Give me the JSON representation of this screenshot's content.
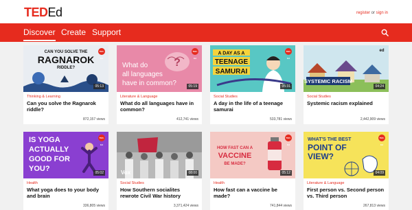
{
  "header": {
    "logo_ted": "TED",
    "logo_ed": "Ed",
    "register": "register",
    "or": " or ",
    "sign_in": "sign in"
  },
  "nav": {
    "items": [
      "Discover",
      "Create",
      "Support"
    ]
  },
  "colors": {
    "brand": "#e62b1e"
  },
  "cards": [
    {
      "thumb_text": [
        "CAN YOU SOLVE THE",
        "RAGNAROK",
        "RIDDLE?"
      ],
      "badge": "TED-Ed",
      "duration": "05:13",
      "subject": "Thinking & Learning",
      "title": "Can you solve the Ragnarok riddle?",
      "views": "872,157 views"
    },
    {
      "thumb_text": [
        "What do",
        "all languages",
        "have in common?"
      ],
      "badge": "TED-Ed",
      "duration": "05:19",
      "subject": "Literature & Language",
      "title": "What do all languages have in common?",
      "views": "412,741 views"
    },
    {
      "thumb_text": [
        "A DAY AS A",
        "TEENAGE",
        "SAMURAI"
      ],
      "badge": "TED-Ed",
      "duration": "05:31",
      "subject": "Social Studies",
      "title": "A day in the life of a teenage samurai",
      "views": "533,781 views"
    },
    {
      "thumb_text": [
        "SYSTEMIC RACISM",
        "ed"
      ],
      "badge": "",
      "duration": "04:24",
      "subject": "Social Studies",
      "title": "Systemic racism explained",
      "views": "2,442,909 views"
    },
    {
      "thumb_text": [
        "IS YOGA",
        "ACTUALLY",
        "GOOD FOR",
        "YOU?"
      ],
      "badge": "TED-Ed",
      "duration": "05:02",
      "subject": "Health",
      "title": "What yoga does to your body and brain",
      "views": "336,805 views"
    },
    {
      "thumb_text": [
        "Vox"
      ],
      "badge": "",
      "duration": "08:00",
      "subject": "Social Studies",
      "title": "How Southern socialites rewrote Civil War history",
      "views": "3,371,424 views"
    },
    {
      "thumb_text": [
        "HOW FAST CAN A",
        "VACCINE",
        "BE MADE?"
      ],
      "badge": "TED-Ed",
      "duration": "05:12",
      "subject": "Health",
      "title": "How fast can a vaccine be made?",
      "views": "741,844 views"
    },
    {
      "thumb_text": [
        "WHAT'S THE BEST",
        "POINT OF",
        "VIEW?"
      ],
      "badge": "TED-Ed",
      "duration": "04:09",
      "subject": "Literature & Language",
      "title": "First person vs. Second person vs. Third person",
      "views": "267,813 views"
    }
  ]
}
